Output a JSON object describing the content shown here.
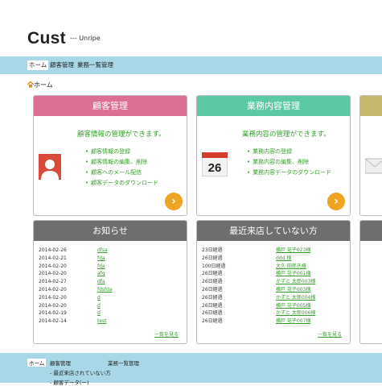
{
  "app": {
    "logo": "Cust",
    "tagline": "--- Unripe"
  },
  "nav": {
    "items": [
      "ホーム",
      "顧客管理",
      "業務一覧管理"
    ]
  },
  "breadcrumb": {
    "label": "ホーム"
  },
  "cards": {
    "customer": {
      "title": "顧客管理",
      "lead": "顧客情報の管理ができます。",
      "items": [
        "顧客情報の登録",
        "顧客情報の編集、削除",
        "顧客へのメール配信",
        "顧客データのダウンロード"
      ],
      "color": "#dd6f95"
    },
    "business": {
      "title": "業務内容管理",
      "lead": "業務内容の管理ができます。",
      "items": [
        "業務内容の登録",
        "業務内容の編集、削除",
        "業務内容データのダウンロード"
      ],
      "calendar_day": "26",
      "color": "#5cc9a6"
    },
    "third": {
      "color": "#c6b86c"
    }
  },
  "news": {
    "title": "お知らせ",
    "rows": [
      {
        "date": "2014-02-26",
        "text": "dfsa"
      },
      {
        "date": "2014-02-21",
        "text": "fda"
      },
      {
        "date": "2014-02-20",
        "text": "fda"
      },
      {
        "date": "2014-02-20",
        "text": "afg"
      },
      {
        "date": "2014-02-27",
        "text": "dfa"
      },
      {
        "date": "2014-02-20",
        "text": "fdsfda"
      },
      {
        "date": "2014-02-20",
        "text": "d"
      },
      {
        "date": "2014-02-20",
        "text": "d"
      },
      {
        "date": "2014-02-19",
        "text": "d"
      },
      {
        "date": "2014-02-14",
        "text": "test"
      }
    ],
    "more": "一覧を見る"
  },
  "recent": {
    "title": "最近来店していない方",
    "rows": [
      {
        "days": "23日経過",
        "name": "横戸 花子023様"
      },
      {
        "days": "26日経過",
        "name": "ddd 様"
      },
      {
        "days": "100日経過",
        "name": "大久 田郎氏様"
      },
      {
        "days": "26日経過",
        "name": "横戸 花子001様"
      },
      {
        "days": "26日経過",
        "name": "かずと 太郎003様"
      },
      {
        "days": "26日経過",
        "name": "横戸 花子003様"
      },
      {
        "days": "26日経過",
        "name": "かずと 太郎004様"
      },
      {
        "days": "26日経過",
        "name": "横戸 花子005様"
      },
      {
        "days": "26日経過",
        "name": "かずと 太郎006様"
      },
      {
        "days": "26日経過",
        "name": "横戸 花子007様"
      }
    ],
    "more": "一覧を見る"
  },
  "footer": {
    "home": "ホーム",
    "customer": "顧客管理",
    "business": "業務一覧管理",
    "sub1": "- 最近来店されていない方",
    "sub2": "- 顧客データ(ー)"
  }
}
